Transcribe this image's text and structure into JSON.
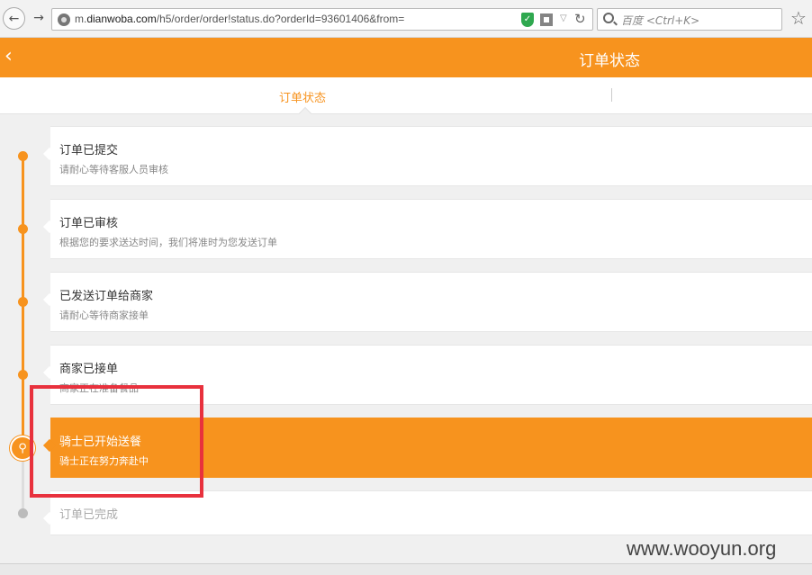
{
  "browser": {
    "url_prefix": "m.",
    "url_domain": "dianwoba.com",
    "url_path": "/h5/order/order!status.do?orderId=93601406&from=",
    "search_placeholder": "百度 <Ctrl+K>"
  },
  "header": {
    "back_glyph": "‹",
    "title": "订单状态"
  },
  "tabs": {
    "active_label": "订单状态"
  },
  "timeline": [
    {
      "title": "订单已提交",
      "desc": "请耐心等待客服人员审核",
      "state": "done"
    },
    {
      "title": "订单已审核",
      "desc": "根据您的要求送达时间，我们将准时为您发送订单",
      "state": "done"
    },
    {
      "title": "已发送订单给商家",
      "desc": "请耐心等待商家接单",
      "state": "done"
    },
    {
      "title": "商家已接单",
      "desc": "商家正在准备餐品",
      "state": "done"
    },
    {
      "title": "骑士已开始送餐",
      "desc": "骑士正在努力奔赴中",
      "state": "active"
    },
    {
      "title": "订单已完成",
      "desc": "",
      "state": "pending"
    }
  ],
  "watermark": "www.wooyun.org",
  "colors": {
    "accent": "#f7931e",
    "highlight": "#e8313d"
  }
}
